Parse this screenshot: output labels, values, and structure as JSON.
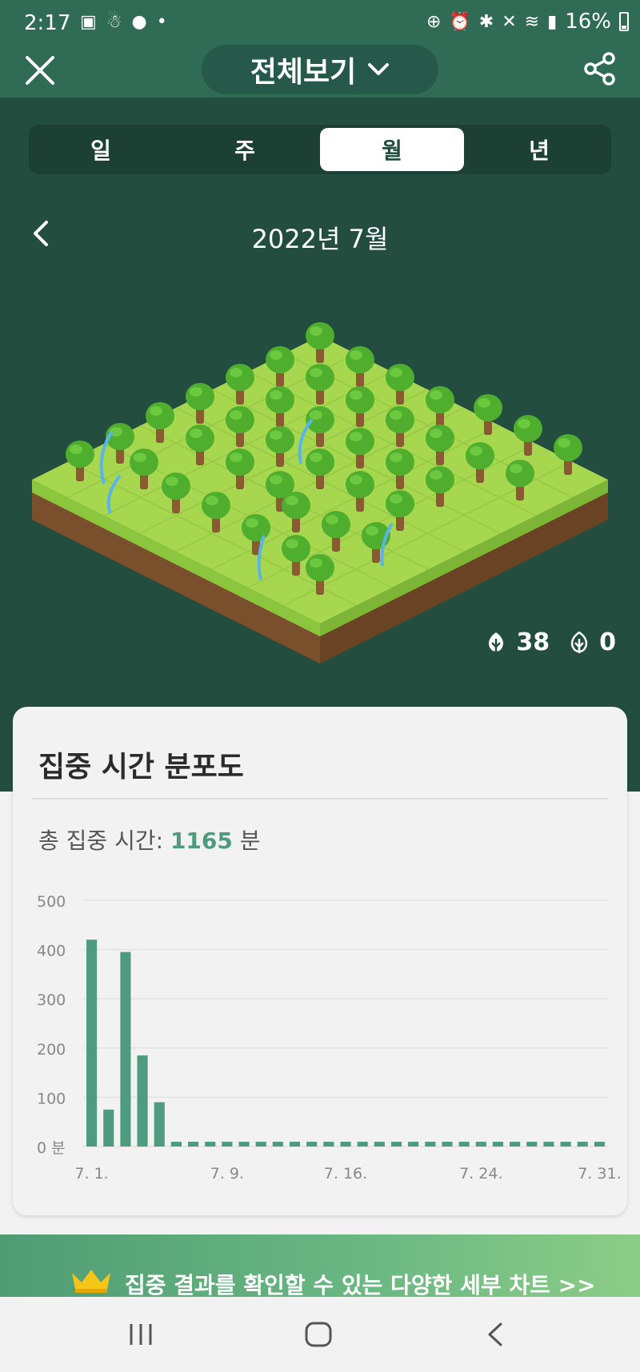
{
  "status_bar": {
    "time": "2:17",
    "battery": "16%"
  },
  "header": {
    "title": "전체보기"
  },
  "tabs": [
    {
      "label": "일",
      "active": false
    },
    {
      "label": "주",
      "active": false
    },
    {
      "label": "월",
      "active": true
    },
    {
      "label": "년",
      "active": false
    }
  ],
  "period": {
    "label": "2022년 7월"
  },
  "counts": {
    "healthy": "38",
    "dead": "0"
  },
  "focus_card": {
    "title": "집중 시간 분포도",
    "total_prefix": "총 집중 시간: ",
    "total_value": "1165",
    "total_unit": " 분"
  },
  "chart_data": {
    "type": "bar",
    "ylim": [
      0,
      500
    ],
    "ytick_labels": [
      "500",
      "400",
      "300",
      "200",
      "100",
      "0 분"
    ],
    "xtick_labels": [
      "7. 1.",
      "7. 9.",
      "7. 16.",
      "7. 24.",
      "7. 31."
    ],
    "xtick_days": [
      1,
      9,
      16,
      24,
      31
    ],
    "x": [
      1,
      2,
      3,
      4,
      5,
      6,
      7,
      8,
      9,
      10,
      11,
      12,
      13,
      14,
      15,
      16,
      17,
      18,
      19,
      20,
      21,
      22,
      23,
      24,
      25,
      26,
      27,
      28,
      29,
      30,
      31
    ],
    "values": [
      420,
      75,
      395,
      185,
      90,
      0,
      0,
      0,
      0,
      0,
      0,
      0,
      0,
      0,
      0,
      0,
      0,
      0,
      0,
      0,
      0,
      0,
      0,
      0,
      0,
      0,
      0,
      0,
      0,
      0,
      0
    ],
    "bar_color": "#4f9b7f",
    "grid": true
  },
  "banner": {
    "text": "집중 결과를 확인할 수 있는 다양한 세부 차트 >>"
  },
  "colors": {
    "header": "#2f6b55",
    "forest_bg": "#234e3f",
    "accent": "#4f9b7f"
  }
}
